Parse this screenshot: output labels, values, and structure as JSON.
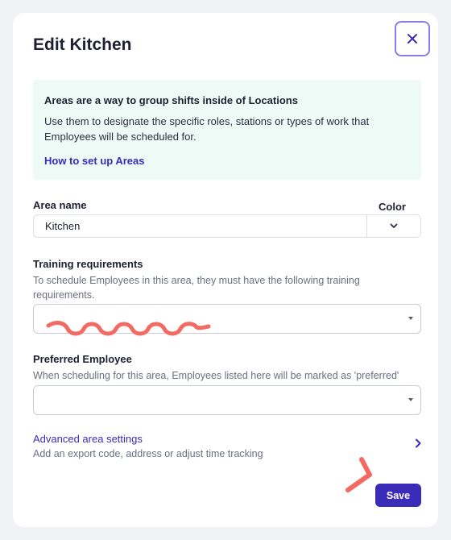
{
  "modal": {
    "title": "Edit Kitchen",
    "close_icon": "close-icon"
  },
  "info": {
    "heading": "Areas are a way to group shifts inside of Locations",
    "text": "Use them to designate the specific roles, stations or types of work that Employees will be scheduled for.",
    "link": "How to set up Areas"
  },
  "area_name": {
    "label": "Area name",
    "value": "Kitchen"
  },
  "color": {
    "label": "Color",
    "icon": "chevron-down-icon"
  },
  "training": {
    "label": "Training requirements",
    "help": "To schedule Employees in this area, they must have the following training requirements.",
    "value": ""
  },
  "preferred": {
    "label": "Preferred Employee",
    "help": "When scheduling for this area, Employees listed here will be marked as 'preferred'",
    "value": ""
  },
  "advanced": {
    "title": "Advanced area settings",
    "subtitle": "Add an export code, address or adjust time tracking",
    "icon": "chevron-right-icon"
  },
  "actions": {
    "save": "Save"
  },
  "colors": {
    "accent": "#3a2bb8",
    "close_border": "#8a7ae6",
    "info_bg": "#eefaf6",
    "annotation": "#f26b63"
  }
}
